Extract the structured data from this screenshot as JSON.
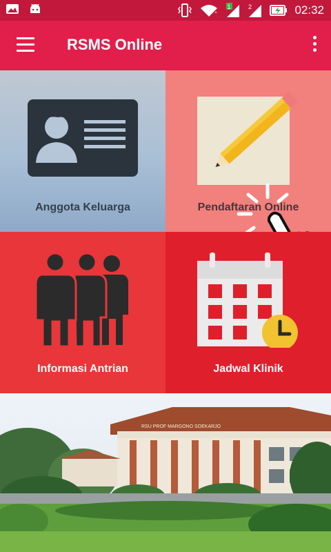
{
  "status_bar": {
    "time": "02:32",
    "sim1": "1",
    "sim2": "2"
  },
  "app_bar": {
    "title": "RSMS Online"
  },
  "tiles": [
    {
      "label": "Anggota Keluarga",
      "icon": "id-card-icon"
    },
    {
      "label": "Pendaftaran Online",
      "icon": "pencil-note-icon"
    },
    {
      "label": "Informasi Antrian",
      "icon": "people-queue-icon"
    },
    {
      "label": "Jadwal Klinik",
      "icon": "calendar-clock-icon"
    }
  ],
  "banner": {
    "building_sign": "RSU PROF MARGONO SOEKARJO"
  },
  "colors": {
    "status_bar": "#c2183b",
    "app_bar": "#e21f4b",
    "tile_member": "#a9bfd6",
    "tile_register": "#f2807d",
    "tile_queue": "#e8363a",
    "tile_schedule": "#e01f2c"
  }
}
